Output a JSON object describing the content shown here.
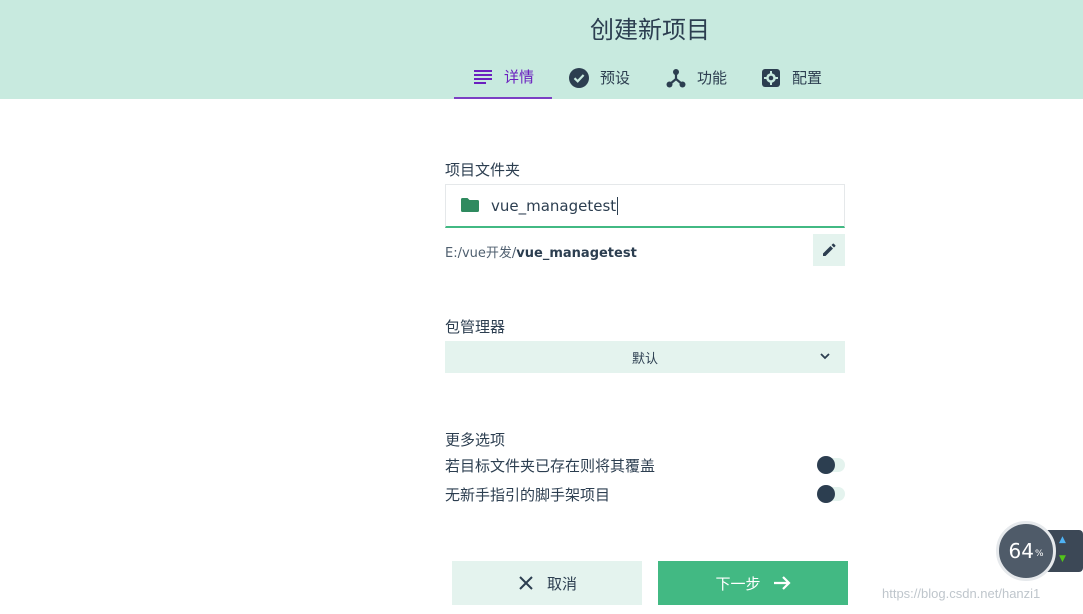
{
  "header": {
    "title": "创建新项目",
    "tabs": [
      {
        "label": "详情",
        "icon": "list-icon",
        "active": true
      },
      {
        "label": "预设",
        "icon": "check-circle-icon",
        "active": false
      },
      {
        "label": "功能",
        "icon": "branch-icon",
        "active": false
      },
      {
        "label": "配置",
        "icon": "gear-icon",
        "active": false
      }
    ]
  },
  "folder": {
    "label": "项目文件夹",
    "value": "vue_managetest",
    "path_prefix": "E:/vue开发/",
    "path_name": "vue_managetest"
  },
  "package_manager": {
    "label": "包管理器",
    "selected": "默认"
  },
  "more_options": {
    "label": "更多选项",
    "items": [
      {
        "label": "若目标文件夹已存在则将其覆盖",
        "enabled": false
      },
      {
        "label": "无新手指引的脚手架项目",
        "enabled": false
      }
    ]
  },
  "actions": {
    "cancel_label": "取消",
    "next_label": "下一步"
  },
  "speed_widget": {
    "percent": "64",
    "unit": "%"
  },
  "watermark": "https://blog.csdn.net/hanzi1",
  "colors": {
    "header_bg": "#c8eadf",
    "accent": "#42b983",
    "tab_active": "#6a1fbf",
    "text": "#2c3e50"
  }
}
